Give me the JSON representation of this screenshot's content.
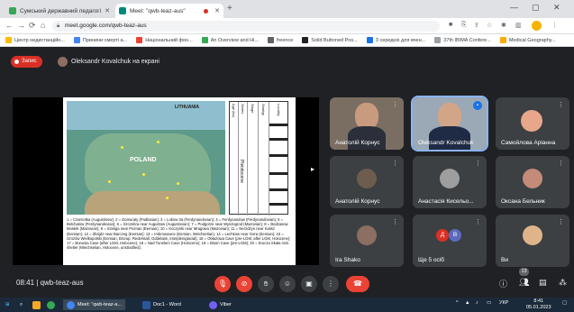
{
  "browser": {
    "tabs": [
      {
        "label": "Сумський державний педагогі",
        "favicon_color": "#34a853"
      },
      {
        "label": "Meet: \"qwb-teaz-aus\"",
        "favicon_color": "#00897b"
      }
    ],
    "url": "meet.google.com/qwb-teaz-aus",
    "bookmarks": [
      {
        "label": "Центр недистанційн...",
        "color": "#fbbc04"
      },
      {
        "label": "Принини смерті а...",
        "color": "#4285f4"
      },
      {
        "label": "Національний фон...",
        "color": "#ea4335"
      },
      {
        "label": "An Overview and Hi...",
        "color": "#34a853"
      },
      {
        "label": "freence",
        "color": "#5f6368"
      },
      {
        "label": "Solid Buttoned Pos...",
        "color": "#202124"
      },
      {
        "label": "З середніх для вчен...",
        "color": "#1a73e8"
      },
      {
        "label": "37th IBIMA Confere...",
        "color": "#9aa0a6"
      },
      {
        "label": "Medical Geography...",
        "color": "#f9ab00"
      }
    ]
  },
  "meet": {
    "recording_label": "Запис",
    "presenter_label": "Oleksandr Kovalchuk на екрані",
    "meeting_time": "08:41",
    "meeting_code": "qwb-teaz-aus",
    "participant_count": "13"
  },
  "slide": {
    "map_labels": {
      "country": "POLAND",
      "region": "LITHUANIA"
    },
    "strat_headers": [
      "Age (ka)",
      "Series",
      "Stage",
      "Stratigr.",
      "Locality"
    ],
    "strat_period": "Pleistocene",
    "caption": "1 = Czarnotka (Augustinow); 2 = Domuraty (Podlasian); 3 = Lokow 3a (Ferdynandovian); 4 = Ferdynandow (Ferdynandovian); 5 = Belchatow (Ferdynandovian); 6 = Szczebra near Augustow (Augustovian); 7 = Podgorze near Wyszogrod (Mazovian); 8 = Bodzasow Mostek (Mazovian); 9 = Szeliga near Poznan (Eemian); 10 = Koczynki near Mragowo (Mazovian); 11 = Nerzdzyn near Kalisz (Eemian); 12 = Zbrijdz near Barczeg (Eemian); 13 = Imbrowowce (Eemian, Weichselian); 14 = Lechkow near Gora (Eemian); 15 = Grozów Wielkopolski (Eemian, Brorup, Rederstall, Oddelaite, interpleniglacial); 16 = Obłazowa Cave (pre-LGM, after LGM, Holocene); 17 = Bonusia Cave (after LGM, Holocene); 18 = Nad Tunelem Cave (Holocene); 19 = Bison Cave (pre-LGM); 20 = Krucza Skała rock shelter (Weichselian, Holocene, unstratified)."
  },
  "participants": [
    {
      "name": "Анатолій Корнус",
      "kind": "camera",
      "bg": "#7a6e63"
    },
    {
      "name": "Oleksandr Kovalchuk",
      "kind": "camera",
      "bg": "#9aa9b5",
      "speaking": true
    },
    {
      "name": "Самойлова Аріанна",
      "kind": "avatar",
      "bg": "#3c4043",
      "avatar_color": "#e8a68a"
    },
    {
      "name": "Анатолій Корнус",
      "kind": "avatar",
      "bg": "#3c4043",
      "avatar_color": "#6d5d4e"
    },
    {
      "name": "Анастасія Кисельо...",
      "kind": "avatar",
      "bg": "#3c4043",
      "avatar_color": "#9e9e9e"
    },
    {
      "name": "Оксана Бельник",
      "kind": "avatar",
      "bg": "#3c4043",
      "avatar_color": "#c48b78"
    },
    {
      "name": "Ira Shako",
      "kind": "avatar",
      "bg": "#3c4043",
      "avatar_color": "#8d6e63"
    },
    {
      "name": "Ще 5 осіб",
      "kind": "group",
      "bg": "#3c4043",
      "initials": [
        "Д",
        "В"
      ]
    },
    {
      "name": "Ви",
      "kind": "avatar",
      "bg": "#3c4043",
      "avatar_color": "#e0b48a"
    }
  ],
  "taskbar": {
    "items": [
      {
        "label": "Meet: \"qwb-teaz-a...",
        "color": "#4285f4"
      },
      {
        "label": "Doc1 - Word",
        "color": "#2b579a"
      },
      {
        "label": "Viber",
        "color": "#7360f2"
      }
    ],
    "lang": "УКР",
    "time": "8:41",
    "date": "05.01.2023"
  }
}
